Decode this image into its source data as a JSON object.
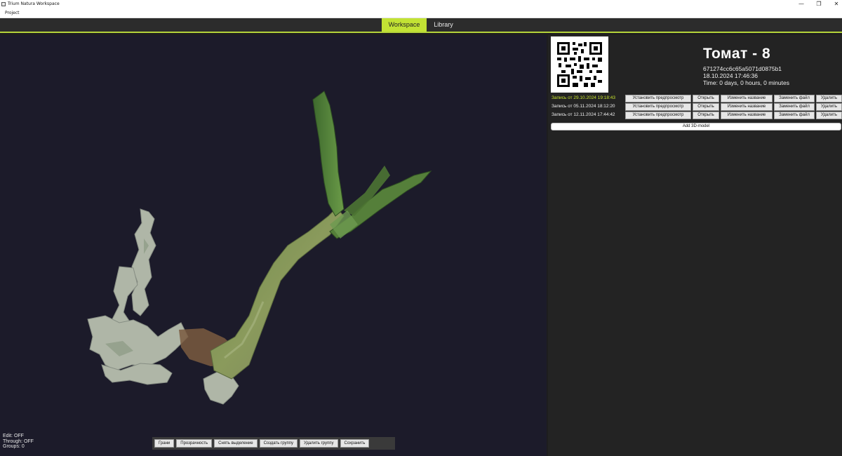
{
  "window": {
    "title": "Trium Natura Workspace",
    "controls": [
      "—",
      "❐",
      "✕"
    ]
  },
  "menu": {
    "project": "Project"
  },
  "tabs": {
    "workspace": "Workspace",
    "library": "Library",
    "active": "Workspace"
  },
  "colors": {
    "accent": "#c2e234",
    "viewport_bg": "#1c1b2a",
    "panel_bg": "#232323"
  },
  "viewport": {
    "status": {
      "edit": "Edit: OFF",
      "through": "Through: OFF",
      "groups": "Groups: 0"
    },
    "toolbar": {
      "faces": "Грани",
      "transparency": "Прозрачность",
      "deselect": "Снять выделение",
      "create_group": "Создать группу",
      "delete_group": "Удалить группу",
      "save": "Сохранить"
    }
  },
  "model": {
    "name": "Томат - 8",
    "id": "671274cc6c65a5071d0875b1",
    "created": "18.10.2024 17:46:36",
    "time": "Time: 0 days, 0 hours, 0 minutes",
    "qr_icon": "qr-code-icon"
  },
  "records": [
    {
      "label": "Запись от 29.10.2024 19:18:43",
      "active": true
    },
    {
      "label": "Запись от 05.11.2024 18:12:20",
      "active": false
    },
    {
      "label": "Запись от 12.11.2024 17:44:42",
      "active": false
    }
  ],
  "record_actions": {
    "set_preview": "Установить предпросмотр",
    "open": "Открыть",
    "rename": "Изменить название",
    "replace_file": "Заменить файл",
    "delete": "Удалить"
  },
  "add_model": "Add 3D-model"
}
